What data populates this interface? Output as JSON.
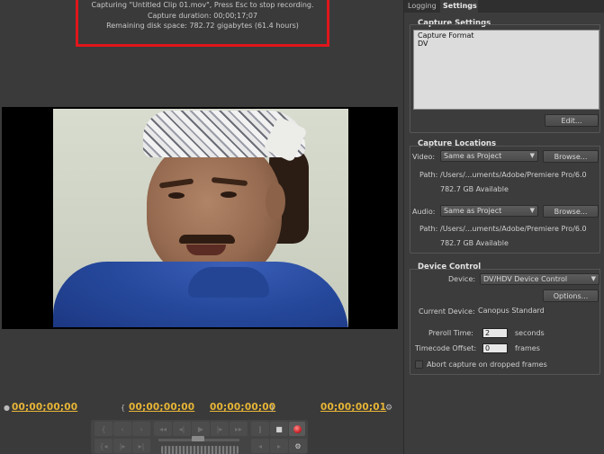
{
  "status": {
    "line1": "Capturing \"Untitled Clip 01.mov\", Press Esc to stop recording.",
    "line2": "Capture duration: 00;00;17;07",
    "line3": "Remaining disk space: 782.72 gigabytes (61.4 hours)"
  },
  "timecodes": {
    "current": "00;00;00;00",
    "in_point": "00;00;00;00",
    "out_point": "00;00;00;00",
    "duration": "00;00;00;01"
  },
  "tabs": [
    {
      "label": "Logging"
    },
    {
      "label": "Settings"
    }
  ],
  "capture_settings": {
    "title": "Capture Settings",
    "format_label": "Capture Format",
    "format_value": "DV",
    "edit_label": "Edit..."
  },
  "capture_locations": {
    "title": "Capture Locations",
    "video_label": "Video:",
    "video_select": "Same as Project",
    "video_browse": "Browse...",
    "video_path_label": "Path:",
    "video_path": "/Users/...uments/Adobe/Premiere Pro/6.0",
    "video_available": "782.7 GB Available",
    "audio_label": "Audio:",
    "audio_select": "Same as Project",
    "audio_browse": "Browse...",
    "audio_path_label": "Path:",
    "audio_path": "/Users/...uments/Adobe/Premiere Pro/6.0",
    "audio_available": "782.7 GB Available"
  },
  "device_control": {
    "title": "Device Control",
    "device_label": "Device:",
    "device_select": "DV/HDV Device Control",
    "options_label": "Options...",
    "current_device_label": "Current Device:",
    "current_device": "Canopus Standard",
    "preroll_label": "Preroll Time:",
    "preroll_value": "2",
    "preroll_unit": "seconds",
    "offset_label": "Timecode Offset:",
    "offset_value": "0",
    "offset_unit": "frames",
    "abort_label": "Abort capture on dropped frames"
  },
  "colors": {
    "timecode": "#e7b536",
    "status_border": "#e0161b"
  }
}
